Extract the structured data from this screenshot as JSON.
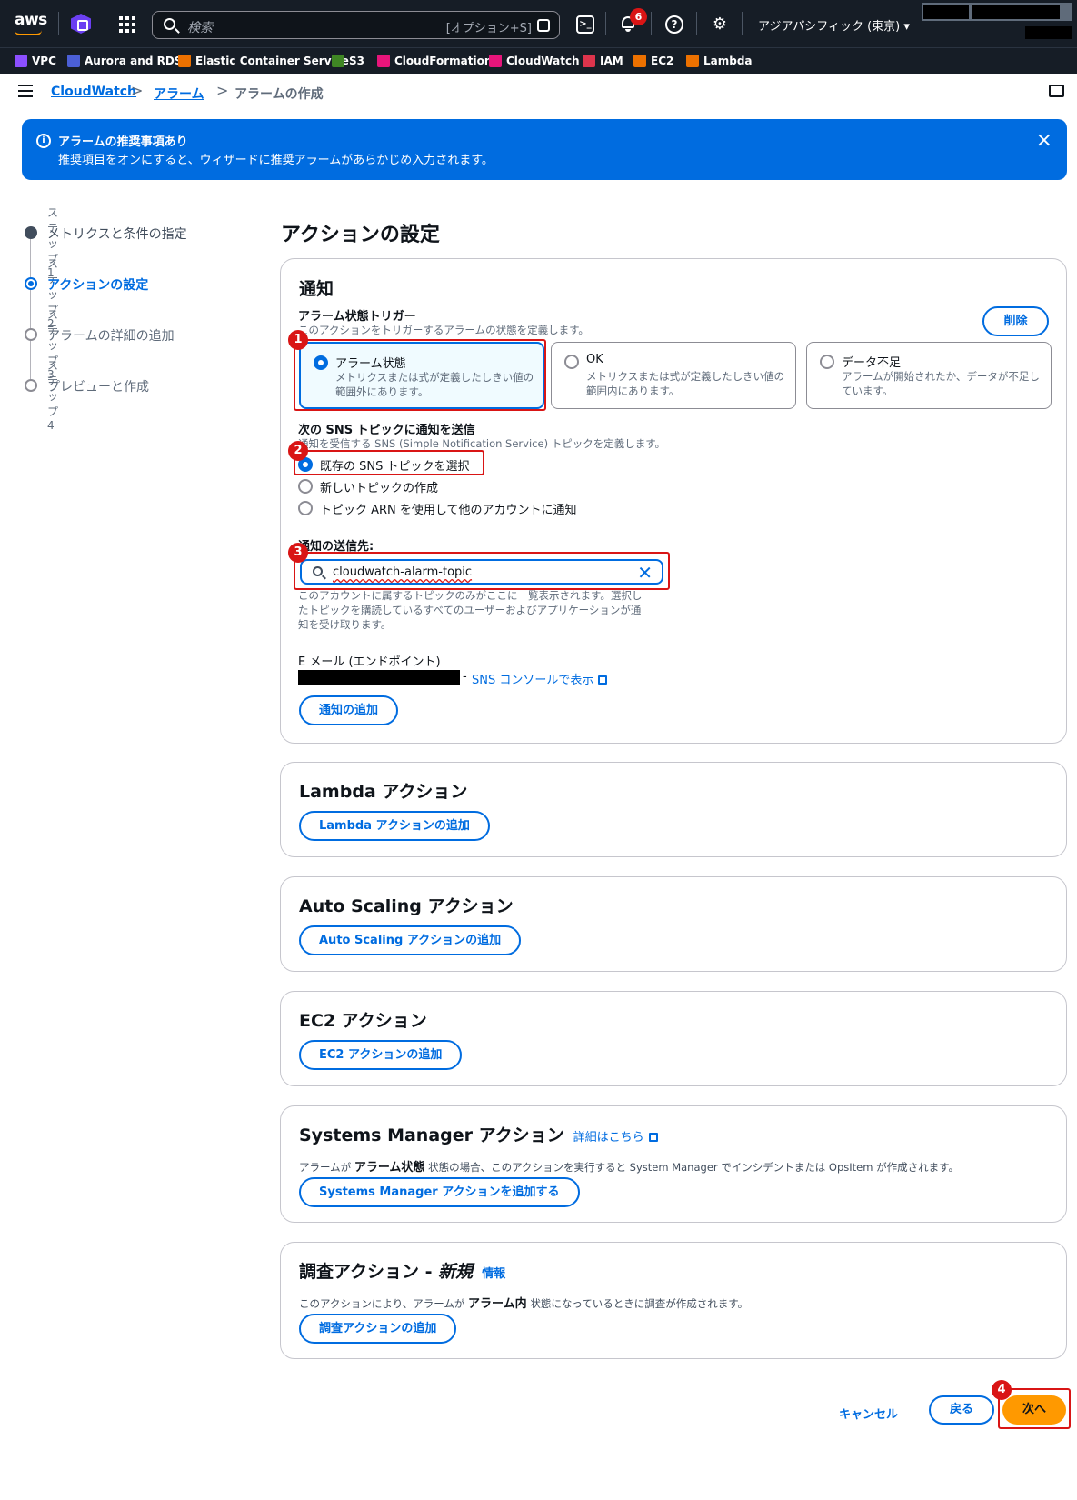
{
  "topbar": {
    "logo": "aws",
    "search_placeholder": "検索",
    "search_hint": "[オプション+S]",
    "notification_count": "6",
    "region": "アジアパシフィック (東京) ▾",
    "icons": [
      "q-developer-icon",
      "services-grid-icon",
      "search-icon",
      "cloudshell-icon",
      "bell-icon",
      "help-icon",
      "gear-icon"
    ]
  },
  "favorites": [
    {
      "label": "VPC",
      "color": "#8c4fff"
    },
    {
      "label": "Aurora and RDS",
      "color": "#4b5fd6"
    },
    {
      "label": "Elastic Container Service",
      "color": "#ed7100"
    },
    {
      "label": "S3",
      "color": "#3f8624"
    },
    {
      "label": "CloudFormation",
      "color": "#e7157b"
    },
    {
      "label": "CloudWatch",
      "color": "#e7157b"
    },
    {
      "label": "IAM",
      "color": "#dd344c"
    },
    {
      "label": "EC2",
      "color": "#ed7100"
    },
    {
      "label": "Lambda",
      "color": "#ed7100"
    }
  ],
  "breadcrumb": {
    "items": [
      "CloudWatch",
      "アラーム",
      "アラームの作成"
    ],
    "separator": ">"
  },
  "flash": {
    "title": "アラームの推奨事項あり",
    "description": "推奨項目をオンにすると、ウィザードに推奨アラームがあらかじめ入力されます。",
    "close": "×"
  },
  "steps": [
    {
      "num": "ステップ1",
      "label": "メトリクスと条件の指定",
      "state": "done"
    },
    {
      "num": "ステップ2",
      "label": "アクションの設定",
      "state": "active"
    },
    {
      "num": "ステップ3",
      "label": "アラームの詳細の追加",
      "state": "future"
    },
    {
      "num": "ステップ4",
      "label": "プレビューと作成",
      "state": "future"
    }
  ],
  "page_title": "アクションの設定",
  "notification": {
    "title": "通知",
    "trigger_label": "アラーム状態トリガー",
    "trigger_desc": "このアクションをトリガーするアラームの状態を定義します。",
    "remove_button": "削除",
    "tiles": [
      {
        "title": "アラーム状態",
        "desc": "メトリクスまたは式が定義したしきい値の範囲外にあります。",
        "selected": true
      },
      {
        "title": "OK",
        "desc": "メトリクスまたは式が定義したしきい値の範囲内にあります。",
        "selected": false
      },
      {
        "title": "データ不足",
        "desc": "アラームが開始されたか、データが不足しています。",
        "selected": false
      }
    ],
    "sns_label": "次の SNS トピックに通知を送信",
    "sns_desc": "通知を受信する SNS (Simple Notification Service) トピックを定義します。",
    "sns_options": [
      "既存の SNS トピックを選択",
      "新しいトピックの作成",
      "トピック ARN を使用して他のアカウントに通知"
    ],
    "sendto_label": "通知の送信先:",
    "sendto_value": "cloudwatch-alarm-topic",
    "sendto_clear": "✕",
    "sendto_help_1": "このアカウントに属するトピックのみがここに一覧表示されます。選択し",
    "sendto_help_2": "たトピックを購読しているすべてのユーザーおよびアプリケーションが通",
    "sendto_help_3": "知を受け取ります。",
    "email_label": "E メール (エンドポイント)",
    "email_sep": "-",
    "email_link": "SNS コンソールで表示",
    "add_button": "通知の追加"
  },
  "lambda": {
    "title": "Lambda アクション",
    "button": "Lambda アクションの追加"
  },
  "autoscaling": {
    "title": "Auto Scaling アクション",
    "button": "Auto Scaling アクションの追加"
  },
  "ec2": {
    "title": "EC2 アクション",
    "button": "EC2 アクションの追加"
  },
  "ssm": {
    "title": "Systems Manager アクション",
    "learn_more": "詳細はこちら",
    "desc_pre": "アラームが",
    "desc_bold": "アラーム状態",
    "desc_post": "状態の場合、このアクションを実行すると System Manager でインシデントまたは OpsItem が作成されます。",
    "button": "Systems Manager アクションを追加する"
  },
  "investigation": {
    "title": "調査アクション - ",
    "title_new": "新規",
    "info": "情報",
    "desc_pre": "このアクションにより、アラームが",
    "desc_bold": "アラーム内",
    "desc_post": "状態になっているときに調査が作成されます。",
    "button": "調査アクションの追加"
  },
  "footer": {
    "cancel": "キャンセル",
    "back": "戻る",
    "next": "次へ"
  },
  "markers": [
    "1",
    "2",
    "3",
    "4"
  ],
  "colors": {
    "primary": "#006ce0",
    "accent": "#ff9900",
    "annotation": "#d91515",
    "topbar": "#161d26"
  }
}
